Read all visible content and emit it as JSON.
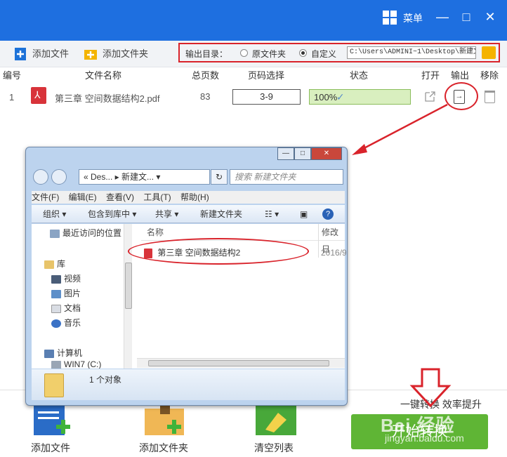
{
  "app": {
    "menu_label": "菜单",
    "minimize_glyph": "—",
    "maximize_glyph": "□",
    "close_glyph": "✕"
  },
  "toolbar": {
    "add_file": "添加文件",
    "add_folder": "添加文件夹"
  },
  "output": {
    "label": "输出目录：",
    "option_original": "原文件夹",
    "option_custom": "自定义",
    "selected": "custom",
    "path": "C:\\Users\\ADMINI~1\\Desktop\\新建文"
  },
  "table": {
    "headers": [
      "编号",
      "文件名称",
      "总页数",
      "页码选择",
      "状态",
      "打开",
      "输出",
      "移除"
    ],
    "rows": [
      {
        "index": "1",
        "filename": "第三章 空间数据结构2.pdf",
        "pages": "83",
        "range": "3-9",
        "status": "100%",
        "progress": 1.0
      }
    ]
  },
  "bottom": {
    "add_file": "添加文件",
    "add_folder": "添加文件夹",
    "clear_list": "清空列表",
    "slogan": "一键转换  效率提升",
    "start": "开始转换"
  },
  "watermark": {
    "text": "Bai  经验",
    "url": "jingyan.baidu.com"
  },
  "explorer": {
    "address": "« Des... ▸ 新建文... ▾",
    "search_placeholder": "搜索 新建文件夹",
    "menu": [
      "文件(F)",
      "编辑(E)",
      "查看(V)",
      "工具(T)",
      "帮助(H)"
    ],
    "commands": [
      "组织 ▾",
      "包含到库中 ▾",
      "共享 ▾",
      "新建文件夹"
    ],
    "nav": {
      "recent": "最近访问的位置",
      "library": "库",
      "video": "视频",
      "pictures": "图片",
      "documents": "文档",
      "music": "音乐",
      "computer": "计算机",
      "drive": "WIN7 (C:)"
    },
    "columns": {
      "name": "名称",
      "modified": "修改日"
    },
    "file": {
      "name": "第三章 空间数据结构2",
      "date": "2016/9"
    },
    "status": "1 个对象"
  },
  "colors": {
    "title_bar": "#1e6fe0",
    "highlight": "#d9232b",
    "start_button": "#5fb535",
    "progress_border": "#8bbd5c"
  }
}
